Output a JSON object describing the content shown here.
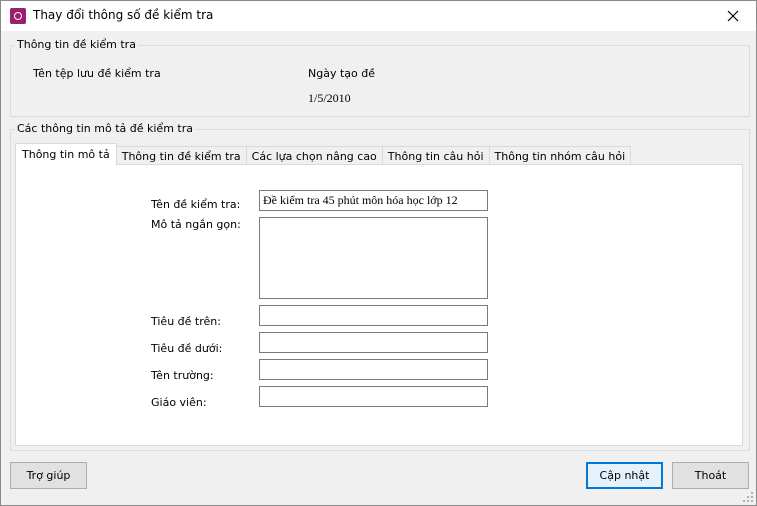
{
  "window": {
    "title": "Thay đổi thông số đề kiểm tra"
  },
  "info_group": {
    "legend": "Thông tin đề kiểm tra",
    "file_label": "Tên tệp lưu đề kiểm tra",
    "date_label": "Ngày tạo đề",
    "date_value": "1/5/2010"
  },
  "desc_group": {
    "legend": "Các thông tin mô tả đề kiểm tra"
  },
  "tabs": [
    {
      "label": "Thông tin mô tả"
    },
    {
      "label": "Thông tin đề kiểm tra"
    },
    {
      "label": "Các lựa chọn nâng cao"
    },
    {
      "label": "Thông tin câu hỏi"
    },
    {
      "label": "Thông tin nhóm câu hỏi"
    }
  ],
  "form": {
    "test_name_label": "Tên đề kiểm tra:",
    "test_name_value": "Đề kiểm tra 45 phút môn hóa học lớp 12",
    "short_desc_label": "Mô tả ngắn gọn:",
    "short_desc_value": "",
    "top_title_label": "Tiêu đề trên:",
    "top_title_value": "",
    "bottom_title_label": "Tiêu đề dưới:",
    "bottom_title_value": "",
    "school_label": "Tên trường:",
    "school_value": "",
    "teacher_label": "Giáo viên:",
    "teacher_value": ""
  },
  "buttons": {
    "help": "Trợ giúp",
    "update": "Cập nhật",
    "exit": "Thoát"
  },
  "icons": {
    "app": "app-logo-icon",
    "close": "close-icon",
    "grip": "resize-grip-icon"
  }
}
